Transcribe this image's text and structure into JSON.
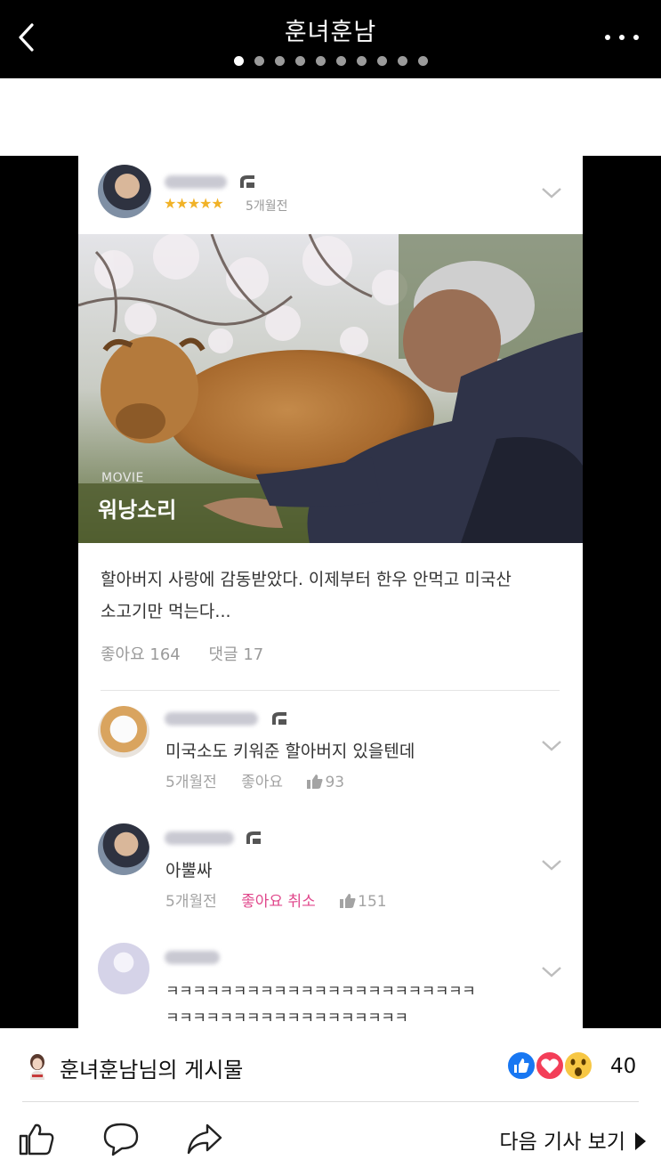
{
  "topbar": {
    "title": "훈녀훈남",
    "page_count": 10,
    "active_page": 1
  },
  "post": {
    "rating_stars": "★★★★★",
    "time_ago": "5개월전",
    "movie_tag": "MOVIE",
    "movie_title": "워낭소리",
    "text_line1": "할아버지 사랑에 감동받았다. 이제부터 한우 안먹고 미국산",
    "text_line2": "소고기만 먹는다...",
    "likes": "좋아요 164",
    "comments": "댓글 17"
  },
  "comments": [
    {
      "text": "미국소도 키워준 할아버지 있을텐데",
      "time": "5개월전",
      "like_label": "좋아요",
      "like_count": "93",
      "liked": false
    },
    {
      "text": "아뿔싸",
      "time": "5개월전",
      "like_label": "좋아요 취소",
      "like_count": "151",
      "liked": true
    },
    {
      "text_line1": "ㅋㅋㅋㅋㅋㅋㅋㅋㅋㅋㅋㅋㅋㅋㅋㅋㅋㅋㅋㅋㅋㅋㅋ",
      "text_line2": "ㅋㅋㅋㅋㅋㅋㅋㅋㅋㅋㅋㅋㅋㅋㅋㅋㅋㅋ"
    }
  ],
  "bottom": {
    "owner_label": "훈녀훈남님의 게시물",
    "reaction_count": "40",
    "next_label": "다음 기사 보기"
  },
  "colors": {
    "accent_pink": "#e0488c",
    "star_gold": "#f1b227",
    "fb_blue": "#1877f2",
    "fb_red": "#f33e58"
  }
}
